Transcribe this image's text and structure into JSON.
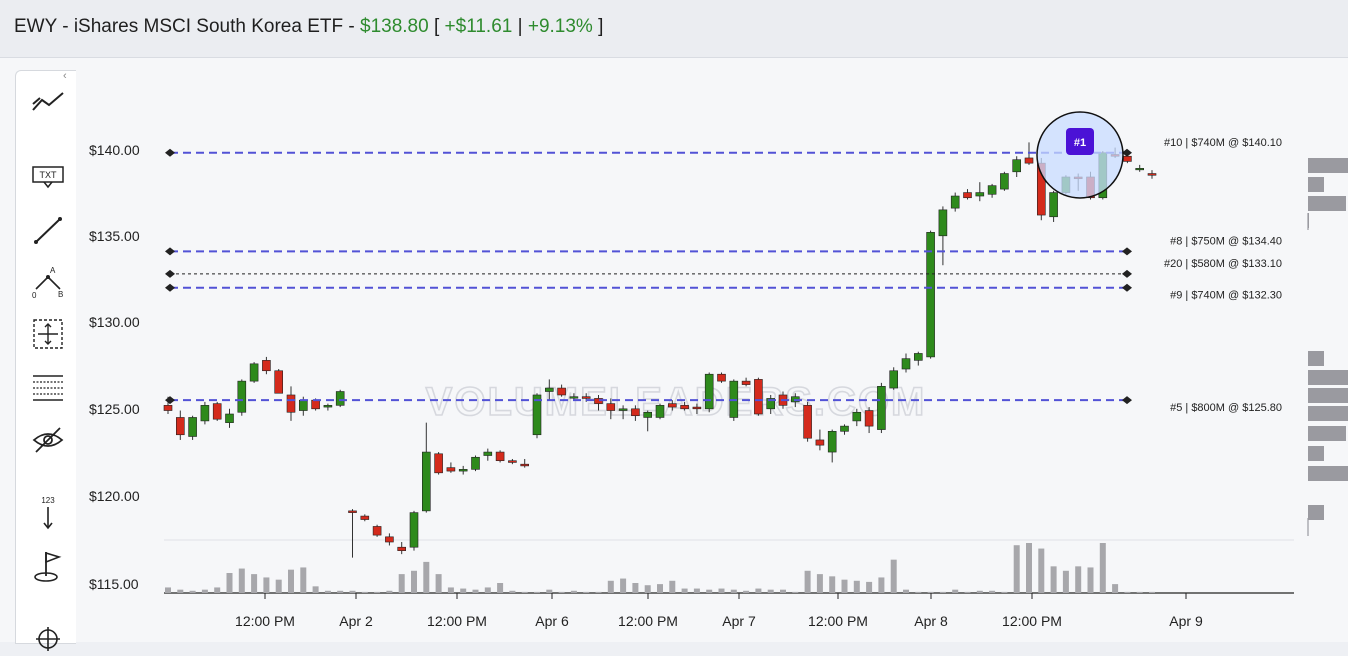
{
  "header": {
    "ticker": "EWY",
    "name": "iShares MSCI South Korea ETF",
    "price": "$138.80",
    "change": "+$11.61",
    "change_pct": "+9.13%",
    "sep1": " - ",
    "sep2": " - ",
    "bracket_open": " [ ",
    "pipe": " | ",
    "bracket_close": " ]"
  },
  "toolbar": {
    "tools": [
      {
        "name": "trend-tool",
        "icon": "trend-line-icon"
      },
      {
        "name": "text-tool",
        "icon": "txt-icon",
        "label": "TXT"
      },
      {
        "name": "line-tool",
        "icon": "line-icon"
      },
      {
        "name": "pattern-tool",
        "icon": "abc-pattern-icon",
        "labels": [
          "A",
          "0",
          "B"
        ]
      },
      {
        "name": "measure-tool",
        "icon": "measure-icon"
      },
      {
        "name": "fib-tool",
        "icon": "fib-lines-icon"
      },
      {
        "name": "hide-tool",
        "icon": "eye-off-icon"
      },
      {
        "name": "count-tool",
        "icon": "counter-icon",
        "label": "123"
      },
      {
        "name": "flag-tool",
        "icon": "flag-icon"
      },
      {
        "name": "move-tool",
        "icon": "move-icon"
      }
    ]
  },
  "watermark": "VOLUMELEADERS.COM",
  "colors": {
    "up": "#2e8a1c",
    "down": "#d42a1c",
    "level": "#5252d6",
    "volume": "#a7a7ab",
    "highlight": "#c8dcff",
    "badge": "#4b12d6"
  },
  "chart_data": {
    "type": "candlestick",
    "y_ticks": [
      "$140.00",
      "$135.00",
      "$130.00",
      "$125.00",
      "$120.00",
      "$115.00"
    ],
    "x_ticks": [
      "12:00 PM",
      "Apr 2",
      "12:00 PM",
      "Apr 6",
      "12:00 PM",
      "Apr 7",
      "12:00 PM",
      "Apr 8",
      "12:00 PM",
      "Apr 9"
    ],
    "ylim": [
      114.5,
      141.5
    ],
    "levels": [
      {
        "label": "#10 | $740M @ $140.10",
        "price": 140.1,
        "style": "dashed-blue"
      },
      {
        "label": "#8 | $750M @ $134.40",
        "price": 134.4,
        "style": "dashed-blue"
      },
      {
        "label": "#20 | $580M @ $133.10",
        "price": 133.1,
        "style": "dashed-black"
      },
      {
        "label": "#9 | $740M @ $132.30",
        "price": 132.3,
        "style": "dashed-blue"
      },
      {
        "label": "#5 | $800M @ $125.80",
        "price": 125.8,
        "style": "dashed-blue"
      }
    ],
    "marker": {
      "label": "#1"
    },
    "candles": [
      [
        125.5,
        126.0,
        125.0,
        125.2,
        0.5
      ],
      [
        124.8,
        125.2,
        123.5,
        123.8,
        0.3
      ],
      [
        123.7,
        124.9,
        123.5,
        124.8,
        0.2
      ],
      [
        124.6,
        125.7,
        124.4,
        125.5,
        0.3
      ],
      [
        125.6,
        125.7,
        124.6,
        124.7,
        0.5
      ],
      [
        124.5,
        125.3,
        124.2,
        125.0,
        1.8
      ],
      [
        125.1,
        127.0,
        124.9,
        126.9,
        2.2
      ],
      [
        126.9,
        128.0,
        126.8,
        127.9,
        1.7
      ],
      [
        128.1,
        128.3,
        127.3,
        127.5,
        1.4
      ],
      [
        127.5,
        127.6,
        126.2,
        126.2,
        1.2
      ],
      [
        126.1,
        126.6,
        124.6,
        125.1,
        2.1
      ],
      [
        125.2,
        126.0,
        124.9,
        125.8,
        2.3
      ],
      [
        125.8,
        125.9,
        125.2,
        125.3,
        0.6
      ],
      [
        125.4,
        125.6,
        125.2,
        125.5,
        0.2
      ],
      [
        125.5,
        126.4,
        125.4,
        126.3,
        0.2
      ],
      [
        119.4,
        119.5,
        116.7,
        119.3,
        0.2
      ],
      [
        119.1,
        119.2,
        118.8,
        118.9,
        0.1
      ],
      [
        118.5,
        118.6,
        117.9,
        118.0,
        0.1
      ],
      [
        117.9,
        118.1,
        117.4,
        117.6,
        0.2
      ],
      [
        117.3,
        117.6,
        116.9,
        117.1,
        1.7
      ],
      [
        117.3,
        119.4,
        117.1,
        119.3,
        2.0
      ],
      [
        119.4,
        124.5,
        119.3,
        122.8,
        2.8
      ],
      [
        122.7,
        122.8,
        121.5,
        121.6,
        1.7
      ],
      [
        121.9,
        122.2,
        121.6,
        121.7,
        0.5
      ],
      [
        121.7,
        122.0,
        121.5,
        121.8,
        0.4
      ],
      [
        121.8,
        122.6,
        121.7,
        122.5,
        0.3
      ],
      [
        122.6,
        123.0,
        122.3,
        122.8,
        0.5
      ],
      [
        122.8,
        122.9,
        122.2,
        122.3,
        0.9
      ],
      [
        122.3,
        122.4,
        122.1,
        122.2,
        0.2
      ],
      [
        122.1,
        122.4,
        121.9,
        122.0,
        0.1
      ],
      [
        123.8,
        126.2,
        123.6,
        126.1,
        0.1
      ],
      [
        126.3,
        127.0,
        125.8,
        126.5,
        0.3
      ],
      [
        126.5,
        126.7,
        126.0,
        126.1,
        0.1
      ],
      [
        126.0,
        126.2,
        125.8,
        126.0,
        0.2
      ],
      [
        126.0,
        126.2,
        125.7,
        125.9,
        0.1
      ],
      [
        125.9,
        126.1,
        125.2,
        125.6,
        0.1
      ],
      [
        125.6,
        125.9,
        124.7,
        125.2,
        1.1
      ],
      [
        125.2,
        125.5,
        124.7,
        125.3,
        1.3
      ],
      [
        125.3,
        125.5,
        124.6,
        124.9,
        0.9
      ],
      [
        124.8,
        125.2,
        124.0,
        125.1,
        0.7
      ],
      [
        124.8,
        125.6,
        124.7,
        125.5,
        0.8
      ],
      [
        125.6,
        125.8,
        125.2,
        125.4,
        1.1
      ],
      [
        125.5,
        125.7,
        125.2,
        125.3,
        0.4
      ],
      [
        125.4,
        125.6,
        125.0,
        125.3,
        0.4
      ],
      [
        125.3,
        127.4,
        125.1,
        127.3,
        0.3
      ],
      [
        127.3,
        127.4,
        126.8,
        126.9,
        0.4
      ],
      [
        124.8,
        127.0,
        124.6,
        126.9,
        0.3
      ],
      [
        126.9,
        127.1,
        126.6,
        126.7,
        0.2
      ],
      [
        127.0,
        127.1,
        124.9,
        125.0,
        0.4
      ],
      [
        125.3,
        126.1,
        125.0,
        125.9,
        0.3
      ],
      [
        126.1,
        126.3,
        125.3,
        125.5,
        0.3
      ],
      [
        125.7,
        126.2,
        125.4,
        126.0,
        0.1
      ],
      [
        125.5,
        125.7,
        123.4,
        123.6,
        2.0
      ],
      [
        123.5,
        124.1,
        122.9,
        123.2,
        1.7
      ],
      [
        122.8,
        124.1,
        122.2,
        124.0,
        1.5
      ],
      [
        124.0,
        124.4,
        123.8,
        124.3,
        1.2
      ],
      [
        124.6,
        125.3,
        124.3,
        125.1,
        1.1
      ],
      [
        125.2,
        125.4,
        123.9,
        124.3,
        1.0
      ],
      [
        124.1,
        126.8,
        123.9,
        126.6,
        1.4
      ],
      [
        126.5,
        127.7,
        126.4,
        127.5,
        3.0
      ],
      [
        127.6,
        128.5,
        127.4,
        128.2,
        0.3
      ],
      [
        128.1,
        128.6,
        127.8,
        128.5,
        0.1
      ],
      [
        128.3,
        135.6,
        128.2,
        135.5,
        0.1
      ],
      [
        135.3,
        137.0,
        133.6,
        136.8,
        0.1
      ],
      [
        136.9,
        137.8,
        136.7,
        137.6,
        0.3
      ],
      [
        137.8,
        138.0,
        137.4,
        137.5,
        0.1
      ],
      [
        137.6,
        138.4,
        137.3,
        137.8,
        0.2
      ],
      [
        137.7,
        138.3,
        137.5,
        138.2,
        0.2
      ],
      [
        138.0,
        139.0,
        137.9,
        138.9,
        0.1
      ],
      [
        139.0,
        139.9,
        138.7,
        139.7,
        4.3
      ],
      [
        139.8,
        140.7,
        139.4,
        139.5,
        4.5
      ],
      [
        139.5,
        139.8,
        136.2,
        136.5,
        4.0
      ],
      [
        136.4,
        137.9,
        136.1,
        137.8,
        2.4
      ],
      [
        137.8,
        138.8,
        137.7,
        138.7,
        2.0
      ],
      [
        138.7,
        138.9,
        137.9,
        138.6,
        2.4
      ],
      [
        138.7,
        139.0,
        137.4,
        137.5,
        2.3
      ],
      [
        137.5,
        140.2,
        137.4,
        140.1,
        4.5
      ],
      [
        140.0,
        140.4,
        139.8,
        139.9,
        0.8
      ],
      [
        139.9,
        140.2,
        139.5,
        139.6,
        0.1
      ],
      [
        139.2,
        139.4,
        139.0,
        139.2,
        0.1
      ],
      [
        138.9,
        139.1,
        138.6,
        138.8,
        0.1
      ]
    ]
  }
}
